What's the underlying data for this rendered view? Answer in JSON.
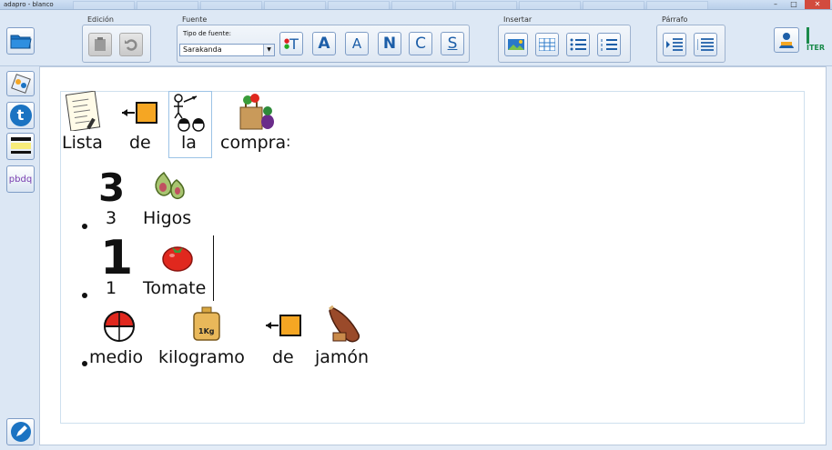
{
  "window": {
    "title": "adapro - blanco",
    "controls": {
      "minimize": "–",
      "maximize": "□",
      "close": "✕"
    }
  },
  "ribbon": {
    "groups": {
      "edicion": "Edición",
      "fuente": "Fuente",
      "insertar": "Insertar",
      "parrafo": "Párrafo"
    },
    "font_type_label": "Tipo de fuente:",
    "font_selected": "Sarakanda",
    "font_buttons": {
      "color_t": "T",
      "grow": "A",
      "shrink": "A",
      "bold": "N",
      "italic": "C",
      "underline": "S"
    },
    "brand": "ITER"
  },
  "sidebar": {
    "spell_letters": "pbdq",
    "t_label": "t"
  },
  "document": {
    "line1": [
      "Lista",
      "de",
      "la",
      "compra",
      ":"
    ],
    "item1": {
      "number": "3",
      "digit_word": "3",
      "noun": "Higos"
    },
    "item2": {
      "number": "1",
      "digit_word": "1",
      "noun": "Tomate"
    },
    "item3": {
      "words": [
        "medio",
        "kilogramo",
        "de",
        "jamón"
      ]
    },
    "weight_label": "1Kg"
  },
  "colors": {
    "accent": "#1c5ea8",
    "sidebar_blue": "#1b73c2",
    "orange_square": "#f5a623",
    "tomato_red": "#e0281e"
  }
}
